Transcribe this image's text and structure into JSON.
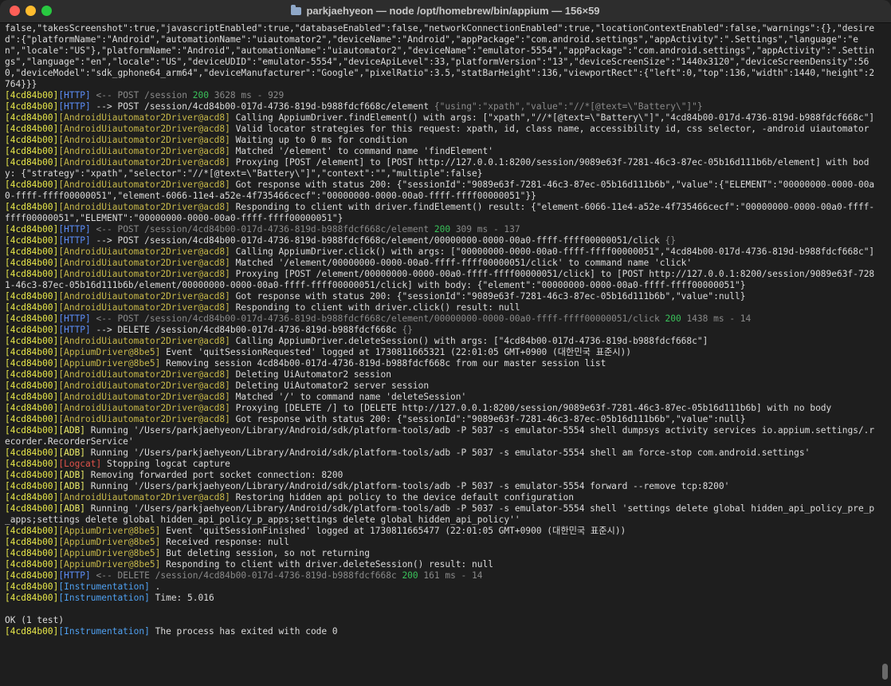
{
  "window": {
    "title": "parkjaehyeon — node /opt/homebrew/bin/appium — 156×59"
  },
  "lines": [
    {
      "segments": [
        {
          "t": "false,\"takesScreenshot\":true,\"javascriptEnabled\":true,\"databaseEnabled\":false,\"networkConnectionEnabled\":true,\"locationContextEnabled\":false,\"warnings\":{},\"desired\":{\"platformName\":\"Android\",\"automationName\":\"uiautomator2\",\"deviceName\":\"Android\",\"appPackage\":\"com.android.settings\",\"appActivity\":\".Settings\",\"language\":\"en\",\"locale\":\"US\"},\"platformName\":\"Android\",\"automationName\":\"uiautomator2\",\"deviceName\":\"emulator-5554\",\"appPackage\":\"com.android.settings\",\"appActivity\":\".Settings\",\"language\":\"en\",\"locale\":\"US\",\"deviceUDID\":\"emulator-5554\",\"deviceApiLevel\":33,\"platformVersion\":\"13\",\"deviceScreenSize\":\"1440x3120\",\"deviceScreenDensity\":560,\"deviceModel\":\"sdk_gphone64_arm64\",\"deviceManufacturer\":\"Google\",\"pixelRatio\":3.5,\"statBarHeight\":136,\"viewportRect\":{\"left\":0,\"top\":136,\"width\":1440,\"height\":2764}}}",
          "c": ""
        }
      ]
    },
    {
      "segments": [
        {
          "t": "[4cd84b00]",
          "c": "tag-id"
        },
        {
          "t": "[HTTP]",
          "c": "tag-http"
        },
        {
          "t": " <-- POST /session ",
          "c": "dim"
        },
        {
          "t": "200",
          "c": "status-ok"
        },
        {
          "t": " 3628 ms - 929",
          "c": "dim"
        }
      ]
    },
    {
      "segments": [
        {
          "t": "[4cd84b00]",
          "c": "tag-id"
        },
        {
          "t": "[HTTP]",
          "c": "tag-http"
        },
        {
          "t": " --> POST /session/4cd84b00-017d-4736-819d-b988fdcf668c/element ",
          "c": ""
        },
        {
          "t": "{\"using\":\"xpath\",\"value\":\"//*[@text=\\\"Battery\\\"]\"}",
          "c": "dim"
        }
      ]
    },
    {
      "segments": [
        {
          "t": "[4cd84b00]",
          "c": "tag-id"
        },
        {
          "t": "[AndroidUiautomator2Driver@acd8]",
          "c": "tag-auto"
        },
        {
          "t": " Calling AppiumDriver.findElement() with args: [\"xpath\",\"//*[@text=\\\"Battery\\\"]\",\"4cd84b00-017d-4736-819d-b988fdcf668c\"]",
          "c": ""
        }
      ]
    },
    {
      "segments": [
        {
          "t": "[4cd84b00]",
          "c": "tag-id"
        },
        {
          "t": "[AndroidUiautomator2Driver@acd8]",
          "c": "tag-auto"
        },
        {
          "t": " Valid locator strategies for this request: xpath, id, class name, accessibility id, css selector, -android uiautomator",
          "c": ""
        }
      ]
    },
    {
      "segments": [
        {
          "t": "[4cd84b00]",
          "c": "tag-id"
        },
        {
          "t": "[AndroidUiautomator2Driver@acd8]",
          "c": "tag-auto"
        },
        {
          "t": " Waiting up to 0 ms for condition",
          "c": ""
        }
      ]
    },
    {
      "segments": [
        {
          "t": "[4cd84b00]",
          "c": "tag-id"
        },
        {
          "t": "[AndroidUiautomator2Driver@acd8]",
          "c": "tag-auto"
        },
        {
          "t": " Matched '/element' to command name 'findElement'",
          "c": ""
        }
      ]
    },
    {
      "segments": [
        {
          "t": "[4cd84b00]",
          "c": "tag-id"
        },
        {
          "t": "[AndroidUiautomator2Driver@acd8]",
          "c": "tag-auto"
        },
        {
          "t": " Proxying [POST /element] to [POST http://127.0.0.1:8200/session/9089e63f-7281-46c3-87ec-05b16d111b6b/element] with body: {\"strategy\":\"xpath\",\"selector\":\"//*[@text=\\\"Battery\\\"]\",\"context\":\"\",\"multiple\":false}",
          "c": ""
        }
      ]
    },
    {
      "segments": [
        {
          "t": "[4cd84b00]",
          "c": "tag-id"
        },
        {
          "t": "[AndroidUiautomator2Driver@acd8]",
          "c": "tag-auto"
        },
        {
          "t": " Got response with status 200: {\"sessionId\":\"9089e63f-7281-46c3-87ec-05b16d111b6b\",\"value\":{\"ELEMENT\":\"00000000-0000-00a0-ffff-ffff00000051\",\"element-6066-11e4-a52e-4f735466cecf\":\"00000000-0000-00a0-ffff-ffff00000051\"}}",
          "c": ""
        }
      ]
    },
    {
      "segments": [
        {
          "t": "[4cd84b00]",
          "c": "tag-id"
        },
        {
          "t": "[AndroidUiautomator2Driver@acd8]",
          "c": "tag-auto"
        },
        {
          "t": " Responding to client with driver.findElement() result: {\"element-6066-11e4-a52e-4f735466cecf\":\"00000000-0000-00a0-ffff-ffff00000051\",\"ELEMENT\":\"00000000-0000-00a0-ffff-ffff00000051\"}",
          "c": ""
        }
      ]
    },
    {
      "segments": [
        {
          "t": "[4cd84b00]",
          "c": "tag-id"
        },
        {
          "t": "[HTTP]",
          "c": "tag-http"
        },
        {
          "t": " <-- POST /session/4cd84b00-017d-4736-819d-b988fdcf668c/element ",
          "c": "dim"
        },
        {
          "t": "200",
          "c": "status-ok"
        },
        {
          "t": " 309 ms - 137",
          "c": "dim"
        }
      ]
    },
    {
      "segments": [
        {
          "t": "[4cd84b00]",
          "c": "tag-id"
        },
        {
          "t": "[HTTP]",
          "c": "tag-http"
        },
        {
          "t": " --> POST /session/4cd84b00-017d-4736-819d-b988fdcf668c/element/00000000-0000-00a0-ffff-ffff00000051/click ",
          "c": ""
        },
        {
          "t": "{}",
          "c": "dim"
        }
      ]
    },
    {
      "segments": [
        {
          "t": "[4cd84b00]",
          "c": "tag-id"
        },
        {
          "t": "[AndroidUiautomator2Driver@acd8]",
          "c": "tag-auto"
        },
        {
          "t": " Calling AppiumDriver.click() with args: [\"00000000-0000-00a0-ffff-ffff00000051\",\"4cd84b00-017d-4736-819d-b988fdcf668c\"]",
          "c": ""
        }
      ]
    },
    {
      "segments": [
        {
          "t": "[4cd84b00]",
          "c": "tag-id"
        },
        {
          "t": "[AndroidUiautomator2Driver@acd8]",
          "c": "tag-auto"
        },
        {
          "t": " Matched '/element/00000000-0000-00a0-ffff-ffff00000051/click' to command name 'click'",
          "c": ""
        }
      ]
    },
    {
      "segments": [
        {
          "t": "[4cd84b00]",
          "c": "tag-id"
        },
        {
          "t": "[AndroidUiautomator2Driver@acd8]",
          "c": "tag-auto"
        },
        {
          "t": " Proxying [POST /element/00000000-0000-00a0-ffff-ffff00000051/click] to [POST http://127.0.0.1:8200/session/9089e63f-7281-46c3-87ec-05b16d111b6b/element/00000000-0000-00a0-ffff-ffff00000051/click] with body: {\"element\":\"00000000-0000-00a0-ffff-ffff00000051\"}",
          "c": ""
        }
      ]
    },
    {
      "segments": [
        {
          "t": "[4cd84b00]",
          "c": "tag-id"
        },
        {
          "t": "[AndroidUiautomator2Driver@acd8]",
          "c": "tag-auto"
        },
        {
          "t": " Got response with status 200: {\"sessionId\":\"9089e63f-7281-46c3-87ec-05b16d111b6b\",\"value\":null}",
          "c": ""
        }
      ]
    },
    {
      "segments": [
        {
          "t": "[4cd84b00]",
          "c": "tag-id"
        },
        {
          "t": "[AndroidUiautomator2Driver@acd8]",
          "c": "tag-auto"
        },
        {
          "t": " Responding to client with driver.click() result: null",
          "c": ""
        }
      ]
    },
    {
      "segments": [
        {
          "t": "[4cd84b00]",
          "c": "tag-id"
        },
        {
          "t": "[HTTP]",
          "c": "tag-http"
        },
        {
          "t": " <-- POST /session/4cd84b00-017d-4736-819d-b988fdcf668c/element/00000000-0000-00a0-ffff-ffff00000051/click ",
          "c": "dim"
        },
        {
          "t": "200",
          "c": "status-ok"
        },
        {
          "t": " 1438 ms - 14",
          "c": "dim"
        }
      ]
    },
    {
      "segments": [
        {
          "t": "[4cd84b00]",
          "c": "tag-id"
        },
        {
          "t": "[HTTP]",
          "c": "tag-http"
        },
        {
          "t": " --> DELETE /session/4cd84b00-017d-4736-819d-b988fdcf668c ",
          "c": ""
        },
        {
          "t": "{}",
          "c": "dim"
        }
      ]
    },
    {
      "segments": [
        {
          "t": "[4cd84b00]",
          "c": "tag-id"
        },
        {
          "t": "[AndroidUiautomator2Driver@acd8]",
          "c": "tag-auto"
        },
        {
          "t": " Calling AppiumDriver.deleteSession() with args: [\"4cd84b00-017d-4736-819d-b988fdcf668c\"]",
          "c": ""
        }
      ]
    },
    {
      "segments": [
        {
          "t": "[4cd84b00]",
          "c": "tag-id"
        },
        {
          "t": "[AppiumDriver@8be5]",
          "c": "tag-appium"
        },
        {
          "t": " Event 'quitSessionRequested' logged at 1730811665321 (22:01:05 GMT+0900 (대한민국 표준시))",
          "c": ""
        }
      ]
    },
    {
      "segments": [
        {
          "t": "[4cd84b00]",
          "c": "tag-id"
        },
        {
          "t": "[AppiumDriver@8be5]",
          "c": "tag-appium"
        },
        {
          "t": " Removing session 4cd84b00-017d-4736-819d-b988fdcf668c from our master session list",
          "c": ""
        }
      ]
    },
    {
      "segments": [
        {
          "t": "[4cd84b00]",
          "c": "tag-id"
        },
        {
          "t": "[AndroidUiautomator2Driver@acd8]",
          "c": "tag-auto"
        },
        {
          "t": " Deleting UiAutomator2 session",
          "c": ""
        }
      ]
    },
    {
      "segments": [
        {
          "t": "[4cd84b00]",
          "c": "tag-id"
        },
        {
          "t": "[AndroidUiautomator2Driver@acd8]",
          "c": "tag-auto"
        },
        {
          "t": " Deleting UiAutomator2 server session",
          "c": ""
        }
      ]
    },
    {
      "segments": [
        {
          "t": "[4cd84b00]",
          "c": "tag-id"
        },
        {
          "t": "[AndroidUiautomator2Driver@acd8]",
          "c": "tag-auto"
        },
        {
          "t": " Matched '/' to command name 'deleteSession'",
          "c": ""
        }
      ]
    },
    {
      "segments": [
        {
          "t": "[4cd84b00]",
          "c": "tag-id"
        },
        {
          "t": "[AndroidUiautomator2Driver@acd8]",
          "c": "tag-auto"
        },
        {
          "t": " Proxying [DELETE /] to [DELETE http://127.0.0.1:8200/session/9089e63f-7281-46c3-87ec-05b16d111b6b] with no body",
          "c": ""
        }
      ]
    },
    {
      "segments": [
        {
          "t": "[4cd84b00]",
          "c": "tag-id"
        },
        {
          "t": "[AndroidUiautomator2Driver@acd8]",
          "c": "tag-auto"
        },
        {
          "t": " Got response with status 200: {\"sessionId\":\"9089e63f-7281-46c3-87ec-05b16d111b6b\",\"value\":null}",
          "c": ""
        }
      ]
    },
    {
      "segments": [
        {
          "t": "[4cd84b00]",
          "c": "tag-id"
        },
        {
          "t": "[ADB]",
          "c": "tag-adb"
        },
        {
          "t": " Running '/Users/parkjaehyeon/Library/Android/sdk/platform-tools/adb -P 5037 -s emulator-5554 shell dumpsys activity services io.appium.settings/.recorder.RecorderService'",
          "c": ""
        }
      ]
    },
    {
      "segments": [
        {
          "t": "[4cd84b00]",
          "c": "tag-id"
        },
        {
          "t": "[ADB]",
          "c": "tag-adb"
        },
        {
          "t": " Running '/Users/parkjaehyeon/Library/Android/sdk/platform-tools/adb -P 5037 -s emulator-5554 shell am force-stop com.android.settings'",
          "c": ""
        }
      ]
    },
    {
      "segments": [
        {
          "t": "[4cd84b00]",
          "c": "tag-id"
        },
        {
          "t": "[Logcat]",
          "c": "tag-logcat"
        },
        {
          "t": " Stopping logcat capture",
          "c": ""
        }
      ]
    },
    {
      "segments": [
        {
          "t": "[4cd84b00]",
          "c": "tag-id"
        },
        {
          "t": "[ADB]",
          "c": "tag-adb"
        },
        {
          "t": " Removing forwarded port socket connection: 8200",
          "c": ""
        }
      ]
    },
    {
      "segments": [
        {
          "t": "[4cd84b00]",
          "c": "tag-id"
        },
        {
          "t": "[ADB]",
          "c": "tag-adb"
        },
        {
          "t": " Running '/Users/parkjaehyeon/Library/Android/sdk/platform-tools/adb -P 5037 -s emulator-5554 forward --remove tcp:8200'",
          "c": ""
        }
      ]
    },
    {
      "segments": [
        {
          "t": "[4cd84b00]",
          "c": "tag-id"
        },
        {
          "t": "[AndroidUiautomator2Driver@acd8]",
          "c": "tag-auto"
        },
        {
          "t": " Restoring hidden api policy to the device default configuration",
          "c": ""
        }
      ]
    },
    {
      "segments": [
        {
          "t": "[4cd84b00]",
          "c": "tag-id"
        },
        {
          "t": "[ADB]",
          "c": "tag-adb"
        },
        {
          "t": " Running '/Users/parkjaehyeon/Library/Android/sdk/platform-tools/adb -P 5037 -s emulator-5554 shell 'settings delete global hidden_api_policy_pre_p_apps;settings delete global hidden_api_policy_p_apps;settings delete global hidden_api_policy''",
          "c": ""
        }
      ]
    },
    {
      "segments": [
        {
          "t": "[4cd84b00]",
          "c": "tag-id"
        },
        {
          "t": "[AppiumDriver@8be5]",
          "c": "tag-appium"
        },
        {
          "t": " Event 'quitSessionFinished' logged at 1730811665477 (22:01:05 GMT+0900 (대한민국 표준시))",
          "c": ""
        }
      ]
    },
    {
      "segments": [
        {
          "t": "[4cd84b00]",
          "c": "tag-id"
        },
        {
          "t": "[AppiumDriver@8be5]",
          "c": "tag-appium"
        },
        {
          "t": " Received response: null",
          "c": ""
        }
      ]
    },
    {
      "segments": [
        {
          "t": "[4cd84b00]",
          "c": "tag-id"
        },
        {
          "t": "[AppiumDriver@8be5]",
          "c": "tag-appium"
        },
        {
          "t": " But deleting session, so not returning",
          "c": ""
        }
      ]
    },
    {
      "segments": [
        {
          "t": "[4cd84b00]",
          "c": "tag-id"
        },
        {
          "t": "[AppiumDriver@8be5]",
          "c": "tag-appium"
        },
        {
          "t": " Responding to client with driver.deleteSession() result: null",
          "c": ""
        }
      ]
    },
    {
      "segments": [
        {
          "t": "[4cd84b00]",
          "c": "tag-id"
        },
        {
          "t": "[HTTP]",
          "c": "tag-http"
        },
        {
          "t": " <-- DELETE /session/4cd84b00-017d-4736-819d-b988fdcf668c ",
          "c": "dim"
        },
        {
          "t": "200",
          "c": "status-ok"
        },
        {
          "t": " 161 ms - 14",
          "c": "dim"
        }
      ]
    },
    {
      "segments": [
        {
          "t": "[4cd84b00]",
          "c": "tag-id"
        },
        {
          "t": "[Instrumentation]",
          "c": "tag-instr"
        },
        {
          "t": " .",
          "c": ""
        }
      ]
    },
    {
      "segments": [
        {
          "t": "[4cd84b00]",
          "c": "tag-id"
        },
        {
          "t": "[Instrumentation]",
          "c": "tag-instr"
        },
        {
          "t": " Time: 5.016",
          "c": ""
        }
      ]
    },
    {
      "segments": [
        {
          "t": " ",
          "c": ""
        }
      ]
    },
    {
      "segments": [
        {
          "t": "OK (1 test)",
          "c": ""
        }
      ]
    },
    {
      "segments": [
        {
          "t": "[4cd84b00]",
          "c": "tag-id"
        },
        {
          "t": "[Instrumentation]",
          "c": "tag-instr"
        },
        {
          "t": " The process has exited with code 0",
          "c": ""
        }
      ]
    }
  ]
}
